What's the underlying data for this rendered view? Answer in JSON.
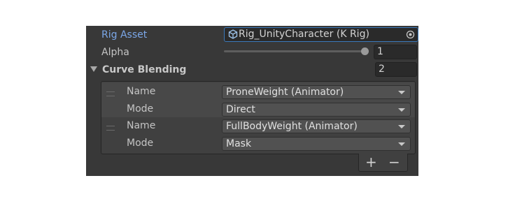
{
  "rig_asset": {
    "label": "Rig Asset",
    "object_name": "Rig_UnityCharacter (K Rig)",
    "icon": "rig-prefab-icon",
    "picker_icon": "object-picker-icon"
  },
  "alpha": {
    "label": "Alpha",
    "value": "1",
    "slider_fraction": 1.0
  },
  "curve_blending": {
    "label": "Curve Blending",
    "count": "2",
    "items": [
      {
        "name_label": "Name",
        "name_value": "ProneWeight (Animator)",
        "mode_label": "Mode",
        "mode_value": "Direct"
      },
      {
        "name_label": "Name",
        "name_value": "FullBodyWeight (Animator)",
        "mode_label": "Mode",
        "mode_value": "Mask"
      }
    ],
    "add_symbol": "+",
    "remove_symbol": "−"
  },
  "colors": {
    "panel_bg": "#383838",
    "rig_label_accent": "#7ba7e8",
    "field_focus_border": "#3a79bb"
  }
}
